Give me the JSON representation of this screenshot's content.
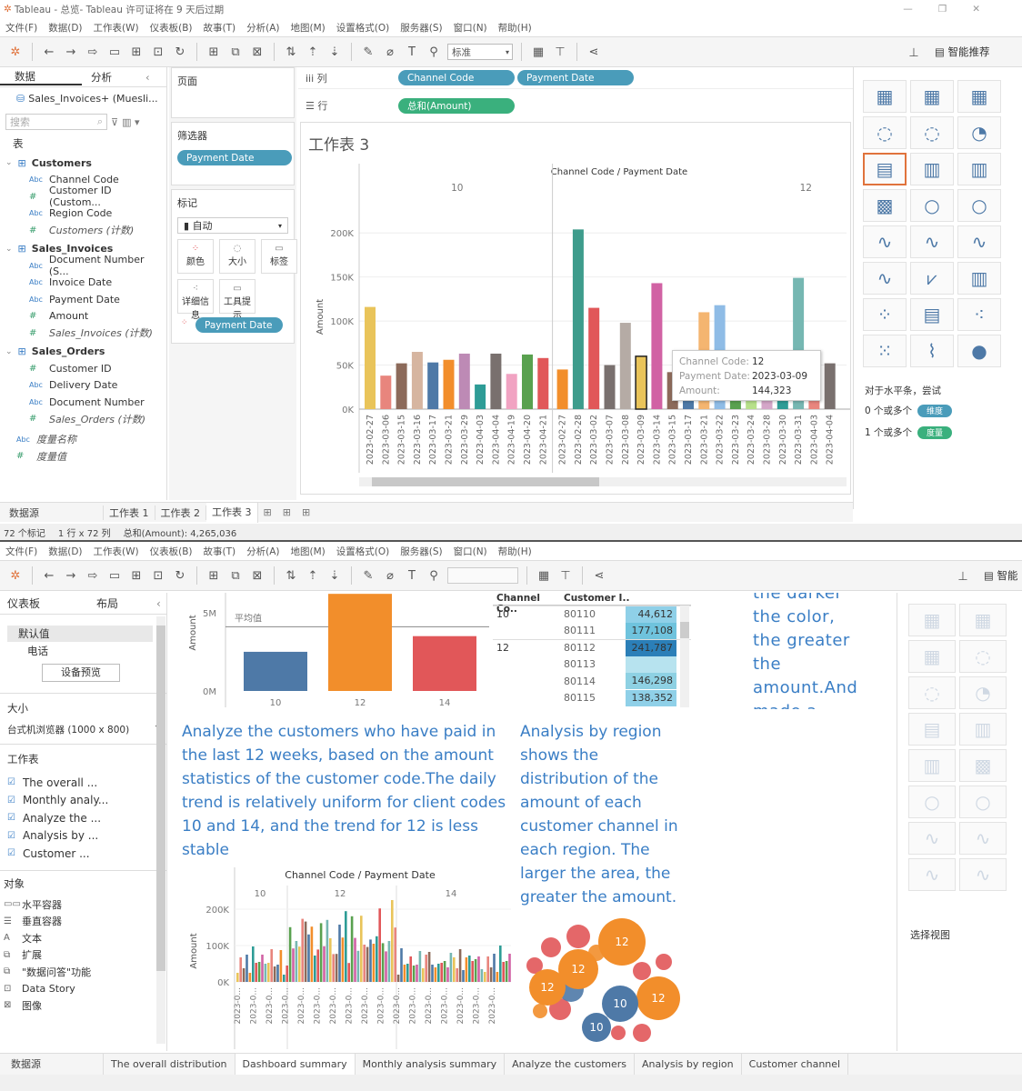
{
  "top": {
    "title": "Tableau - 总览- Tableau 许可证将在 9 天后过期",
    "menus": [
      "文件(F)",
      "数据(D)",
      "工作表(W)",
      "仪表板(B)",
      "故事(T)",
      "分析(A)",
      "地图(M)",
      "设置格式(O)",
      "服务器(S)",
      "窗口(N)",
      "帮助(H)"
    ],
    "standard_select": "标准",
    "smart": "智能推荐",
    "datapane": {
      "tab_data": "数据",
      "tab_analysis": "分析",
      "source": "Sales_Invoices+ (Muesli...",
      "search_placeholder": "搜索",
      "tables_label": "表",
      "groups": [
        {
          "name": "Customers",
          "fields": [
            {
              "t": "abc",
              "n": "Channel Code"
            },
            {
              "t": "num",
              "n": "Customer ID (Custom..."
            },
            {
              "t": "abc",
              "n": "Region Code"
            },
            {
              "t": "num",
              "n": "Customers (计数)",
              "i": true
            }
          ]
        },
        {
          "name": "Sales_Invoices",
          "fields": [
            {
              "t": "abc",
              "n": "Document Number (S..."
            },
            {
              "t": "abc",
              "n": "Invoice Date"
            },
            {
              "t": "abc",
              "n": "Payment Date"
            },
            {
              "t": "num",
              "n": "Amount"
            },
            {
              "t": "num",
              "n": "Sales_Invoices (计数)",
              "i": true
            }
          ]
        },
        {
          "name": "Sales_Orders",
          "fields": [
            {
              "t": "num",
              "n": "Customer ID"
            },
            {
              "t": "abc",
              "n": "Delivery Date"
            },
            {
              "t": "abc",
              "n": "Document Number"
            },
            {
              "t": "num",
              "n": "Sales_Orders (计数)",
              "i": true
            }
          ]
        }
      ],
      "measure_names": "度量名称",
      "measure_values": "度量值"
    },
    "pages_label": "页面",
    "filters_label": "筛选器",
    "filter_pill": "Payment Date",
    "marks_label": "标记",
    "marks_type": "自动",
    "mark_buttons": [
      "颜色",
      "大小",
      "标签",
      "详细信息",
      "工具提示"
    ],
    "marks_pill": "Payment Date",
    "columns_label": "列",
    "rows_label": "行",
    "col_pills": [
      "Channel Code",
      "Payment Date"
    ],
    "row_pill": "总和(Amount)",
    "sheet_title": "工作表 3",
    "suggest_text": "对于水平条，尝试",
    "suggest_line1": "0 个或多个",
    "suggest_badge1": "维度",
    "suggest_line2": "1 个或多个",
    "suggest_badge2": "度量",
    "bottom_tabs": [
      "数据源",
      "工作表 1",
      "工作表 2",
      "工作表 3"
    ],
    "status": {
      "marks": "72 个标记",
      "rows": "1 行 x 72 列",
      "sum": "总和(Amount): 4,265,036"
    },
    "tooltip": {
      "k1": "Channel Code:",
      "v1": "12",
      "k2": "Payment Date:",
      "v2": "2023-03-09",
      "k3": "Amount:",
      "v3": "144,323"
    }
  },
  "chart_data": [
    {
      "type": "bar",
      "title": "Channel Code / Payment Date",
      "ylabel": "Amount",
      "ylim": [
        0,
        220000
      ],
      "yticks": [
        "0K",
        "50K",
        "100K",
        "150K",
        "200K"
      ],
      "panels": [
        {
          "name": "10",
          "categories": [
            "2023-02-27",
            "2023-03-06",
            "2023-03-15",
            "2023-03-16",
            "2023-03-17",
            "2023-03-21",
            "2023-03-29",
            "2023-04-03",
            "2023-04-04",
            "2023-04-19",
            "2023-04-20",
            "2023-04-21"
          ],
          "values": [
            116000,
            38000,
            52000,
            65000,
            53000,
            56000,
            63000,
            28000,
            63000,
            40000,
            62000,
            58000
          ],
          "colors": [
            "#e9c45a",
            "#e8857d",
            "#8c6a5a",
            "#d6b5a0",
            "#4e79a7",
            "#f28e2b",
            "#bd8ab5",
            "#2e9c96",
            "#79706e",
            "#f1a3c2",
            "#59a14f",
            "#e15759"
          ]
        },
        {
          "name": "12",
          "categories": [
            "2023-02-27",
            "2023-02-28",
            "2023-03-02",
            "2023-03-07",
            "2023-03-08",
            "2023-03-09",
            "2023-03-14",
            "2023-03-15",
            "2023-03-17",
            "2023-03-21",
            "2023-03-22",
            "2023-03-23",
            "2023-03-24",
            "2023-03-28",
            "2023-03-30",
            "2023-03-31",
            "2023-04-03",
            "2023-04-04"
          ],
          "values": [
            45000,
            204000,
            115000,
            50000,
            98000,
            60000,
            143000,
            42000,
            44000,
            110000,
            118000,
            34000,
            30000,
            52000,
            54000,
            149000,
            46000,
            52000
          ],
          "colors": [
            "#f28e2b",
            "#3e9c8c",
            "#e15759",
            "#79706e",
            "#b5aba5",
            "#e9c45a",
            "#d162a4",
            "#8c6a5a",
            "#4e79a7",
            "#f4b570",
            "#8fbce6",
            "#59a14f",
            "#b7e08a",
            "#d4a6c8",
            "#2e9c96",
            "#76b7b2",
            "#e8857d",
            "#79706e"
          ]
        }
      ]
    },
    {
      "type": "bar",
      "title": "",
      "ylabel": "Amount",
      "categories": [
        "10",
        "12",
        "14"
      ],
      "values": [
        2500000,
        6200000,
        3500000
      ],
      "colors": [
        "#4e79a7",
        "#f28e2b",
        "#e15759"
      ],
      "reference_line_label": "平均值",
      "yticks": [
        "0M",
        "5M"
      ],
      "ylim": [
        0,
        6500000
      ]
    }
  ],
  "bottom": {
    "menus": [
      "文件(F)",
      "数据(D)",
      "工作表(W)",
      "仪表板(B)",
      "故事(T)",
      "分析(A)",
      "地图(M)",
      "设置格式(O)",
      "服务器(S)",
      "窗口(N)",
      "帮助(H)"
    ],
    "smart_short": "智能",
    "left": {
      "tab_dash": "仪表板",
      "tab_layout": "布局",
      "device_default": "默认值",
      "device_phone": "电话",
      "device_preview": "设备预览",
      "size_label": "大小",
      "size_value": "台式机浏览器 (1000 x 800)",
      "sheets_label": "工作表",
      "sheets": [
        "The overall ...",
        "Monthly analy...",
        "Analyze the ...",
        "Analysis by ...",
        "Customer ..."
      ],
      "objects_label": "对象",
      "objects": [
        "水平容器",
        "垂直容器",
        "文本",
        "扩展",
        "\"数据问答\"功能",
        "Data Story",
        "图像"
      ]
    },
    "table": {
      "headers": [
        "Channel Co..",
        "Customer I.."
      ],
      "rows": [
        {
          "ch": "10",
          "id": "80110",
          "val": "44,612"
        },
        {
          "ch": "",
          "id": "80111",
          "val": "177,108"
        },
        {
          "ch": "12",
          "id": "80112",
          "val": "241,787"
        },
        {
          "ch": "",
          "id": "80113",
          "val": ""
        },
        {
          "ch": "",
          "id": "80114",
          "val": "146,298"
        },
        {
          "ch": "",
          "id": "80115",
          "val": "138,352"
        }
      ]
    },
    "text_right": "the darker the color, the greater the amount.And made a monthly",
    "text_analyze": "Analyze the customers who have paid in the last 12 weeks, based on the amount statistics of the customer code.The daily trend is relatively uniform for client codes 10 and 14, and the trend for 12 is less stable",
    "text_region": "Analysis by region shows the distribution of the amount of each customer channel in each region. The larger the area, the greater the amount.",
    "mini_chart": {
      "title": "Channel Code / Payment Date",
      "panels": [
        "10",
        "12",
        "14"
      ],
      "ylabel": "Amount",
      "yticks": [
        "0K",
        "100K",
        "200K"
      ],
      "xlabel": "2023-0..."
    },
    "bubbles": [
      "12",
      "12",
      "12",
      "12",
      "10",
      "10"
    ],
    "select_view": "选择视图",
    "tabs": [
      "数据源",
      "The overall distribution",
      "Dashboard summary",
      "Monthly analysis summary",
      "Analyze the customers",
      "Analysis by region",
      "Customer channel"
    ]
  }
}
